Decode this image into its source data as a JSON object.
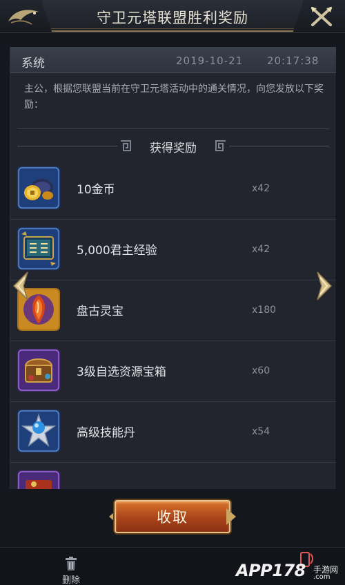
{
  "header": {
    "title": "守卫元塔联盟胜利奖励",
    "back_icon": "back-icon",
    "close_icon": "close-icon"
  },
  "mail": {
    "sender": "系统",
    "date": "2019-10-21",
    "time": "20:17:38",
    "body": "主公，根据您联盟当前在守卫元塔活动中的通关情况，向您发放以下奖励："
  },
  "rewards_section": {
    "title": "获得奖励",
    "items": [
      {
        "name": "10金币",
        "qty": "x42",
        "icon": "gold-coin-icon"
      },
      {
        "name": "5,000君主经验",
        "qty": "x42",
        "icon": "experience-book-icon"
      },
      {
        "name": "盘古灵宝",
        "qty": "x180",
        "icon": "red-gem-icon"
      },
      {
        "name": "3级自选资源宝箱",
        "qty": "x60",
        "icon": "resource-chest-icon"
      },
      {
        "name": "高级技能丹",
        "qty": "x54",
        "icon": "skill-pill-icon"
      }
    ]
  },
  "actions": {
    "claim_label": "收取",
    "delete_label": "删除"
  },
  "watermark": {
    "text": "APP178",
    "sub": "手游网",
    "sub2": ".com"
  },
  "colors": {
    "background": "#14171d",
    "panel": "#22252d",
    "claim_button": "#c25a22",
    "gold_trim": "#e8c58a"
  }
}
